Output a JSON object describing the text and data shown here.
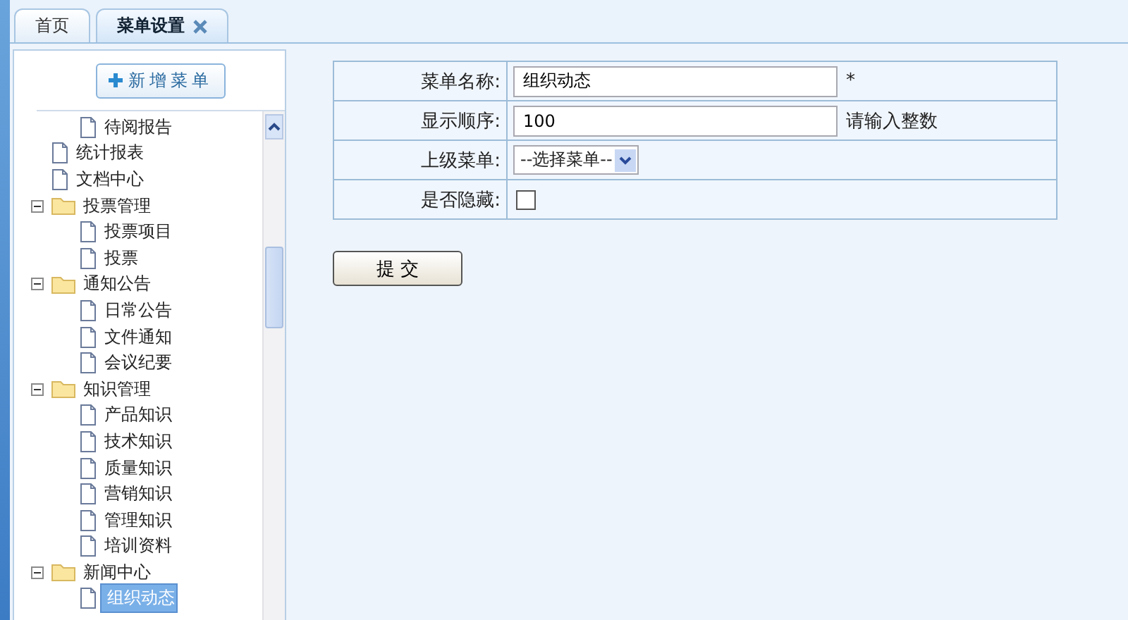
{
  "tabs": [
    {
      "label": "首页",
      "selected": false,
      "closable": false
    },
    {
      "label": "菜单设置",
      "selected": true,
      "closable": true
    }
  ],
  "sidebar": {
    "add_button": "新增菜单",
    "tree": [
      {
        "children": [
          {
            "kind": "file",
            "label": "待阅报告",
            "selected": false
          }
        ]
      },
      {
        "kind": "file",
        "label": "统计报表",
        "selected": false
      },
      {
        "kind": "file",
        "label": "文档中心",
        "selected": false
      },
      {
        "kind": "folder",
        "label": "投票管理",
        "expanded": true,
        "children": [
          {
            "kind": "file",
            "label": "投票项目",
            "selected": false
          },
          {
            "kind": "file",
            "label": "投票",
            "selected": false
          }
        ]
      },
      {
        "kind": "folder",
        "label": "通知公告",
        "expanded": true,
        "children": [
          {
            "kind": "file",
            "label": "日常公告",
            "selected": false
          },
          {
            "kind": "file",
            "label": "文件通知",
            "selected": false
          },
          {
            "kind": "file",
            "label": "会议纪要",
            "selected": false
          }
        ]
      },
      {
        "kind": "folder",
        "label": "知识管理",
        "expanded": true,
        "children": [
          {
            "kind": "file",
            "label": "产品知识",
            "selected": false
          },
          {
            "kind": "file",
            "label": "技术知识",
            "selected": false
          },
          {
            "kind": "file",
            "label": "质量知识",
            "selected": false
          },
          {
            "kind": "file",
            "label": "营销知识",
            "selected": false
          },
          {
            "kind": "file",
            "label": "管理知识",
            "selected": false
          },
          {
            "kind": "file",
            "label": "培训资料",
            "selected": false
          }
        ]
      },
      {
        "kind": "folder",
        "label": "新闻中心",
        "expanded": true,
        "children": [
          {
            "kind": "file",
            "label": "组织动态",
            "selected": true
          }
        ]
      }
    ]
  },
  "form": {
    "rows": [
      {
        "kind": "text",
        "label": "菜单名称:",
        "value": "组织动态",
        "note": "*"
      },
      {
        "kind": "text",
        "label": "显示顺序:",
        "value": "100",
        "note": "请输入整数"
      },
      {
        "kind": "select",
        "label": "上级菜单:",
        "value": "--选择菜单--"
      },
      {
        "kind": "checkbox",
        "label": "是否隐藏:",
        "checked": false
      }
    ],
    "submit": "提 交"
  }
}
